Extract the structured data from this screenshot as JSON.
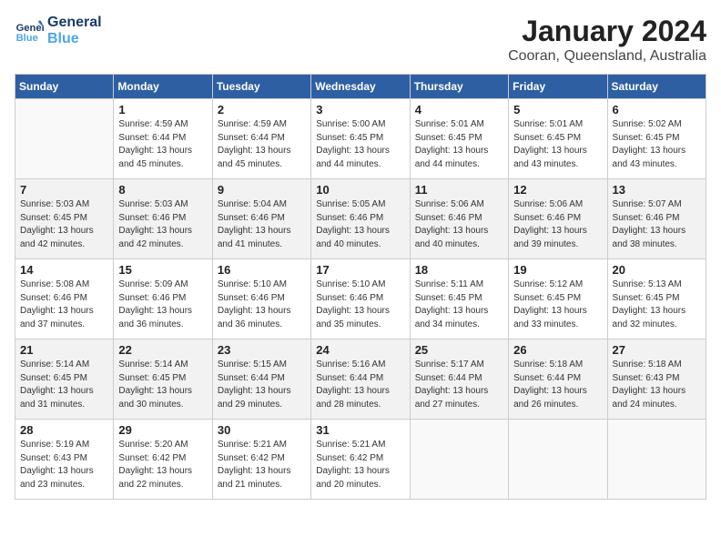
{
  "logo": {
    "line1": "General",
    "line2": "Blue"
  },
  "title": "January 2024",
  "location": "Cooran, Queensland, Australia",
  "weekdays": [
    "Sunday",
    "Monday",
    "Tuesday",
    "Wednesday",
    "Thursday",
    "Friday",
    "Saturday"
  ],
  "weeks": [
    [
      {
        "day": "",
        "info": ""
      },
      {
        "day": "1",
        "info": "Sunrise: 4:59 AM\nSunset: 6:44 PM\nDaylight: 13 hours\nand 45 minutes."
      },
      {
        "day": "2",
        "info": "Sunrise: 4:59 AM\nSunset: 6:44 PM\nDaylight: 13 hours\nand 45 minutes."
      },
      {
        "day": "3",
        "info": "Sunrise: 5:00 AM\nSunset: 6:45 PM\nDaylight: 13 hours\nand 44 minutes."
      },
      {
        "day": "4",
        "info": "Sunrise: 5:01 AM\nSunset: 6:45 PM\nDaylight: 13 hours\nand 44 minutes."
      },
      {
        "day": "5",
        "info": "Sunrise: 5:01 AM\nSunset: 6:45 PM\nDaylight: 13 hours\nand 43 minutes."
      },
      {
        "day": "6",
        "info": "Sunrise: 5:02 AM\nSunset: 6:45 PM\nDaylight: 13 hours\nand 43 minutes."
      }
    ],
    [
      {
        "day": "7",
        "info": "Sunrise: 5:03 AM\nSunset: 6:45 PM\nDaylight: 13 hours\nand 42 minutes."
      },
      {
        "day": "8",
        "info": "Sunrise: 5:03 AM\nSunset: 6:46 PM\nDaylight: 13 hours\nand 42 minutes."
      },
      {
        "day": "9",
        "info": "Sunrise: 5:04 AM\nSunset: 6:46 PM\nDaylight: 13 hours\nand 41 minutes."
      },
      {
        "day": "10",
        "info": "Sunrise: 5:05 AM\nSunset: 6:46 PM\nDaylight: 13 hours\nand 40 minutes."
      },
      {
        "day": "11",
        "info": "Sunrise: 5:06 AM\nSunset: 6:46 PM\nDaylight: 13 hours\nand 40 minutes."
      },
      {
        "day": "12",
        "info": "Sunrise: 5:06 AM\nSunset: 6:46 PM\nDaylight: 13 hours\nand 39 minutes."
      },
      {
        "day": "13",
        "info": "Sunrise: 5:07 AM\nSunset: 6:46 PM\nDaylight: 13 hours\nand 38 minutes."
      }
    ],
    [
      {
        "day": "14",
        "info": "Sunrise: 5:08 AM\nSunset: 6:46 PM\nDaylight: 13 hours\nand 37 minutes."
      },
      {
        "day": "15",
        "info": "Sunrise: 5:09 AM\nSunset: 6:46 PM\nDaylight: 13 hours\nand 36 minutes."
      },
      {
        "day": "16",
        "info": "Sunrise: 5:10 AM\nSunset: 6:46 PM\nDaylight: 13 hours\nand 36 minutes."
      },
      {
        "day": "17",
        "info": "Sunrise: 5:10 AM\nSunset: 6:46 PM\nDaylight: 13 hours\nand 35 minutes."
      },
      {
        "day": "18",
        "info": "Sunrise: 5:11 AM\nSunset: 6:45 PM\nDaylight: 13 hours\nand 34 minutes."
      },
      {
        "day": "19",
        "info": "Sunrise: 5:12 AM\nSunset: 6:45 PM\nDaylight: 13 hours\nand 33 minutes."
      },
      {
        "day": "20",
        "info": "Sunrise: 5:13 AM\nSunset: 6:45 PM\nDaylight: 13 hours\nand 32 minutes."
      }
    ],
    [
      {
        "day": "21",
        "info": "Sunrise: 5:14 AM\nSunset: 6:45 PM\nDaylight: 13 hours\nand 31 minutes."
      },
      {
        "day": "22",
        "info": "Sunrise: 5:14 AM\nSunset: 6:45 PM\nDaylight: 13 hours\nand 30 minutes."
      },
      {
        "day": "23",
        "info": "Sunrise: 5:15 AM\nSunset: 6:44 PM\nDaylight: 13 hours\nand 29 minutes."
      },
      {
        "day": "24",
        "info": "Sunrise: 5:16 AM\nSunset: 6:44 PM\nDaylight: 13 hours\nand 28 minutes."
      },
      {
        "day": "25",
        "info": "Sunrise: 5:17 AM\nSunset: 6:44 PM\nDaylight: 13 hours\nand 27 minutes."
      },
      {
        "day": "26",
        "info": "Sunrise: 5:18 AM\nSunset: 6:44 PM\nDaylight: 13 hours\nand 26 minutes."
      },
      {
        "day": "27",
        "info": "Sunrise: 5:18 AM\nSunset: 6:43 PM\nDaylight: 13 hours\nand 24 minutes."
      }
    ],
    [
      {
        "day": "28",
        "info": "Sunrise: 5:19 AM\nSunset: 6:43 PM\nDaylight: 13 hours\nand 23 minutes."
      },
      {
        "day": "29",
        "info": "Sunrise: 5:20 AM\nSunset: 6:42 PM\nDaylight: 13 hours\nand 22 minutes."
      },
      {
        "day": "30",
        "info": "Sunrise: 5:21 AM\nSunset: 6:42 PM\nDaylight: 13 hours\nand 21 minutes."
      },
      {
        "day": "31",
        "info": "Sunrise: 5:21 AM\nSunset: 6:42 PM\nDaylight: 13 hours\nand 20 minutes."
      },
      {
        "day": "",
        "info": ""
      },
      {
        "day": "",
        "info": ""
      },
      {
        "day": "",
        "info": ""
      }
    ]
  ]
}
